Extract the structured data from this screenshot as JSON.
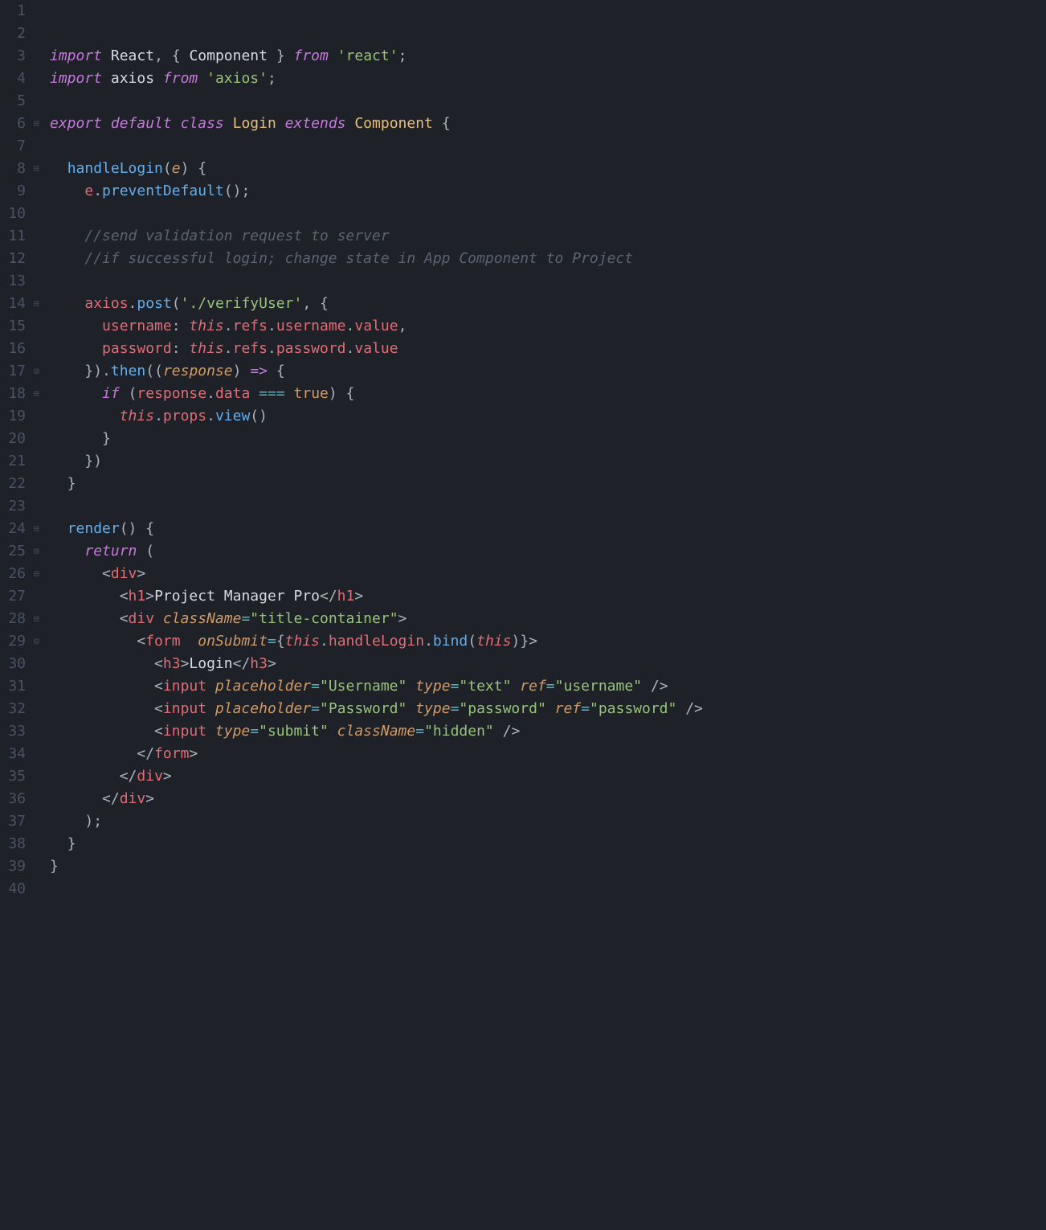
{
  "lines": [
    {
      "num": "1",
      "fold": "",
      "tokens": []
    },
    {
      "num": "2",
      "fold": "",
      "tokens": []
    },
    {
      "num": "3",
      "fold": "",
      "tokens": [
        {
          "cls": "kw-purple",
          "t": "import"
        },
        {
          "cls": "punct",
          "t": " "
        },
        {
          "cls": "white",
          "t": "React"
        },
        {
          "cls": "punct",
          "t": ", "
        },
        {
          "cls": "brace",
          "t": "{ "
        },
        {
          "cls": "white",
          "t": "Component"
        },
        {
          "cls": "brace",
          "t": " } "
        },
        {
          "cls": "kw-purple",
          "t": "from"
        },
        {
          "cls": "punct",
          "t": " "
        },
        {
          "cls": "string",
          "t": "'react'"
        },
        {
          "cls": "punct",
          "t": ";"
        }
      ]
    },
    {
      "num": "4",
      "fold": "",
      "tokens": [
        {
          "cls": "kw-purple",
          "t": "import"
        },
        {
          "cls": "punct",
          "t": " "
        },
        {
          "cls": "white",
          "t": "axios"
        },
        {
          "cls": "punct",
          "t": " "
        },
        {
          "cls": "kw-purple",
          "t": "from"
        },
        {
          "cls": "punct",
          "t": " "
        },
        {
          "cls": "string",
          "t": "'axios'"
        },
        {
          "cls": "punct",
          "t": ";"
        }
      ]
    },
    {
      "num": "5",
      "fold": "",
      "tokens": []
    },
    {
      "num": "6",
      "fold": "⊟",
      "tokens": [
        {
          "cls": "kw-purple",
          "t": "export"
        },
        {
          "cls": "punct",
          "t": " "
        },
        {
          "cls": "kw-purple",
          "t": "default"
        },
        {
          "cls": "punct",
          "t": " "
        },
        {
          "cls": "kw-purple",
          "t": "class"
        },
        {
          "cls": "punct",
          "t": " "
        },
        {
          "cls": "class-yellow",
          "t": "Login"
        },
        {
          "cls": "punct",
          "t": " "
        },
        {
          "cls": "kw-purple",
          "t": "extends"
        },
        {
          "cls": "punct",
          "t": " "
        },
        {
          "cls": "class-yellow",
          "t": "Component"
        },
        {
          "cls": "punct",
          "t": " "
        },
        {
          "cls": "brace",
          "t": "{"
        }
      ]
    },
    {
      "num": "7",
      "fold": "",
      "tokens": [
        {
          "cls": "indent-guide",
          "t": "  "
        }
      ]
    },
    {
      "num": "8",
      "fold": "⊟",
      "tokens": [
        {
          "cls": "punct",
          "t": "  "
        },
        {
          "cls": "ident-blue",
          "t": "handleLogin"
        },
        {
          "cls": "brace",
          "t": "("
        },
        {
          "cls": "param-orange",
          "t": "e"
        },
        {
          "cls": "brace",
          "t": ")"
        },
        {
          "cls": "punct",
          "t": " "
        },
        {
          "cls": "brace",
          "t": "{"
        }
      ]
    },
    {
      "num": "9",
      "fold": "",
      "tokens": [
        {
          "cls": "punct",
          "t": "    "
        },
        {
          "cls": "prop-red",
          "t": "e"
        },
        {
          "cls": "punct",
          "t": "."
        },
        {
          "cls": "ident-blue",
          "t": "preventDefault"
        },
        {
          "cls": "brace",
          "t": "()"
        },
        {
          "cls": "punct",
          "t": ";"
        }
      ]
    },
    {
      "num": "10",
      "fold": "",
      "tokens": [
        {
          "cls": "punct",
          "t": "    "
        }
      ]
    },
    {
      "num": "11",
      "fold": "",
      "tokens": [
        {
          "cls": "punct",
          "t": "    "
        },
        {
          "cls": "comment",
          "t": "//send validation request to server"
        }
      ]
    },
    {
      "num": "12",
      "fold": "",
      "tokens": [
        {
          "cls": "punct",
          "t": "    "
        },
        {
          "cls": "comment",
          "t": "//if successful login; change state in App Component to Project"
        }
      ]
    },
    {
      "num": "13",
      "fold": "",
      "tokens": [
        {
          "cls": "punct",
          "t": "    "
        }
      ]
    },
    {
      "num": "14",
      "fold": "⊟",
      "tokens": [
        {
          "cls": "punct",
          "t": "    "
        },
        {
          "cls": "prop-red",
          "t": "axios"
        },
        {
          "cls": "punct",
          "t": "."
        },
        {
          "cls": "ident-blue",
          "t": "post"
        },
        {
          "cls": "brace",
          "t": "("
        },
        {
          "cls": "string",
          "t": "'./verifyUser'"
        },
        {
          "cls": "punct",
          "t": ", "
        },
        {
          "cls": "brace",
          "t": "{"
        }
      ]
    },
    {
      "num": "15",
      "fold": "",
      "tokens": [
        {
          "cls": "punct",
          "t": "      "
        },
        {
          "cls": "prop-red",
          "t": "username"
        },
        {
          "cls": "punct",
          "t": ": "
        },
        {
          "cls": "this-red",
          "t": "this"
        },
        {
          "cls": "punct",
          "t": "."
        },
        {
          "cls": "prop-red",
          "t": "refs"
        },
        {
          "cls": "punct",
          "t": "."
        },
        {
          "cls": "prop-red",
          "t": "username"
        },
        {
          "cls": "punct",
          "t": "."
        },
        {
          "cls": "prop-red",
          "t": "value"
        },
        {
          "cls": "punct",
          "t": ","
        }
      ]
    },
    {
      "num": "16",
      "fold": "",
      "tokens": [
        {
          "cls": "punct",
          "t": "      "
        },
        {
          "cls": "prop-red",
          "t": "password"
        },
        {
          "cls": "punct",
          "t": ": "
        },
        {
          "cls": "this-red",
          "t": "this"
        },
        {
          "cls": "punct",
          "t": "."
        },
        {
          "cls": "prop-red",
          "t": "refs"
        },
        {
          "cls": "punct",
          "t": "."
        },
        {
          "cls": "prop-red",
          "t": "password"
        },
        {
          "cls": "punct",
          "t": "."
        },
        {
          "cls": "prop-red",
          "t": "value"
        }
      ]
    },
    {
      "num": "17",
      "fold": "⊟",
      "tokens": [
        {
          "cls": "punct",
          "t": "    "
        },
        {
          "cls": "brace",
          "t": "})"
        },
        {
          "cls": "punct",
          "t": "."
        },
        {
          "cls": "ident-blue",
          "t": "then"
        },
        {
          "cls": "brace",
          "t": "(("
        },
        {
          "cls": "param-orange",
          "t": "response"
        },
        {
          "cls": "brace",
          "t": ")"
        },
        {
          "cls": "punct",
          "t": " "
        },
        {
          "cls": "kw-purple-plain",
          "t": "=>"
        },
        {
          "cls": "punct",
          "t": " "
        },
        {
          "cls": "brace",
          "t": "{"
        }
      ]
    },
    {
      "num": "18",
      "fold": "⊟",
      "tokens": [
        {
          "cls": "punct",
          "t": "      "
        },
        {
          "cls": "kw-purple",
          "t": "if"
        },
        {
          "cls": "punct",
          "t": " "
        },
        {
          "cls": "brace",
          "t": "("
        },
        {
          "cls": "prop-red",
          "t": "response"
        },
        {
          "cls": "punct",
          "t": "."
        },
        {
          "cls": "prop-red",
          "t": "data"
        },
        {
          "cls": "punct",
          "t": " "
        },
        {
          "cls": "operator",
          "t": "==="
        },
        {
          "cls": "punct",
          "t": " "
        },
        {
          "cls": "const-orange",
          "t": "true"
        },
        {
          "cls": "brace",
          "t": ")"
        },
        {
          "cls": "punct",
          "t": " "
        },
        {
          "cls": "brace",
          "t": "{"
        }
      ]
    },
    {
      "num": "19",
      "fold": "",
      "tokens": [
        {
          "cls": "punct",
          "t": "        "
        },
        {
          "cls": "this-red",
          "t": "this"
        },
        {
          "cls": "punct",
          "t": "."
        },
        {
          "cls": "prop-red",
          "t": "props"
        },
        {
          "cls": "punct",
          "t": "."
        },
        {
          "cls": "ident-blue",
          "t": "view"
        },
        {
          "cls": "brace",
          "t": "()"
        }
      ]
    },
    {
      "num": "20",
      "fold": "",
      "tokens": [
        {
          "cls": "punct",
          "t": "      "
        },
        {
          "cls": "brace",
          "t": "}"
        }
      ]
    },
    {
      "num": "21",
      "fold": "",
      "tokens": [
        {
          "cls": "punct",
          "t": "    "
        },
        {
          "cls": "brace",
          "t": "})"
        }
      ]
    },
    {
      "num": "22",
      "fold": "",
      "tokens": [
        {
          "cls": "punct",
          "t": "  "
        },
        {
          "cls": "brace",
          "t": "}"
        }
      ]
    },
    {
      "num": "23",
      "fold": "",
      "tokens": [
        {
          "cls": "punct",
          "t": "  "
        }
      ]
    },
    {
      "num": "24",
      "fold": "⊟",
      "tokens": [
        {
          "cls": "punct",
          "t": "  "
        },
        {
          "cls": "ident-blue",
          "t": "render"
        },
        {
          "cls": "brace",
          "t": "()"
        },
        {
          "cls": "punct",
          "t": " "
        },
        {
          "cls": "brace",
          "t": "{"
        }
      ]
    },
    {
      "num": "25",
      "fold": "⊟",
      "tokens": [
        {
          "cls": "punct",
          "t": "    "
        },
        {
          "cls": "kw-purple",
          "t": "return"
        },
        {
          "cls": "punct",
          "t": " "
        },
        {
          "cls": "brace",
          "t": "("
        }
      ]
    },
    {
      "num": "26",
      "fold": "⊟",
      "tokens": [
        {
          "cls": "punct",
          "t": "      "
        },
        {
          "cls": "tag-angle",
          "t": "<"
        },
        {
          "cls": "tag-red",
          "t": "div"
        },
        {
          "cls": "tag-angle",
          "t": ">"
        }
      ]
    },
    {
      "num": "27",
      "fold": "",
      "tokens": [
        {
          "cls": "punct",
          "t": "        "
        },
        {
          "cls": "tag-angle",
          "t": "<"
        },
        {
          "cls": "tag-red",
          "t": "h1"
        },
        {
          "cls": "tag-angle",
          "t": ">"
        },
        {
          "cls": "white",
          "t": "Project Manager Pro"
        },
        {
          "cls": "tag-angle",
          "t": "</"
        },
        {
          "cls": "tag-red",
          "t": "h1"
        },
        {
          "cls": "tag-angle",
          "t": ">"
        }
      ]
    },
    {
      "num": "28",
      "fold": "⊟",
      "tokens": [
        {
          "cls": "punct",
          "t": "        "
        },
        {
          "cls": "tag-angle",
          "t": "<"
        },
        {
          "cls": "tag-red",
          "t": "div"
        },
        {
          "cls": "punct",
          "t": " "
        },
        {
          "cls": "attr-name",
          "t": "className"
        },
        {
          "cls": "operator",
          "t": "="
        },
        {
          "cls": "string",
          "t": "\"title-container\""
        },
        {
          "cls": "tag-angle",
          "t": ">"
        }
      ]
    },
    {
      "num": "29",
      "fold": "⊟",
      "tokens": [
        {
          "cls": "punct",
          "t": "          "
        },
        {
          "cls": "tag-angle",
          "t": "<"
        },
        {
          "cls": "tag-red",
          "t": "form"
        },
        {
          "cls": "punct",
          "t": "  "
        },
        {
          "cls": "attr-name",
          "t": "onSubmit"
        },
        {
          "cls": "operator",
          "t": "="
        },
        {
          "cls": "brace",
          "t": "{"
        },
        {
          "cls": "this-red",
          "t": "this"
        },
        {
          "cls": "punct",
          "t": "."
        },
        {
          "cls": "prop-red",
          "t": "handleLogin"
        },
        {
          "cls": "punct",
          "t": "."
        },
        {
          "cls": "ident-blue",
          "t": "bind"
        },
        {
          "cls": "brace",
          "t": "("
        },
        {
          "cls": "this-red",
          "t": "this"
        },
        {
          "cls": "brace",
          "t": ")}"
        },
        {
          "cls": "tag-angle",
          "t": ">"
        }
      ]
    },
    {
      "num": "30",
      "fold": "",
      "tokens": [
        {
          "cls": "punct",
          "t": "            "
        },
        {
          "cls": "tag-angle",
          "t": "<"
        },
        {
          "cls": "tag-red",
          "t": "h3"
        },
        {
          "cls": "tag-angle",
          "t": ">"
        },
        {
          "cls": "white",
          "t": "Login"
        },
        {
          "cls": "tag-angle",
          "t": "</"
        },
        {
          "cls": "tag-red",
          "t": "h3"
        },
        {
          "cls": "tag-angle",
          "t": ">"
        }
      ]
    },
    {
      "num": "31",
      "fold": "",
      "tokens": [
        {
          "cls": "punct",
          "t": "            "
        },
        {
          "cls": "tag-angle",
          "t": "<"
        },
        {
          "cls": "tag-red",
          "t": "input"
        },
        {
          "cls": "punct",
          "t": " "
        },
        {
          "cls": "attr-name",
          "t": "placeholder"
        },
        {
          "cls": "operator",
          "t": "="
        },
        {
          "cls": "string",
          "t": "\"Username\""
        },
        {
          "cls": "punct",
          "t": " "
        },
        {
          "cls": "attr-name",
          "t": "type"
        },
        {
          "cls": "operator",
          "t": "="
        },
        {
          "cls": "string",
          "t": "\"text\""
        },
        {
          "cls": "punct",
          "t": " "
        },
        {
          "cls": "attr-name",
          "t": "ref"
        },
        {
          "cls": "operator",
          "t": "="
        },
        {
          "cls": "string",
          "t": "\"username\""
        },
        {
          "cls": "punct",
          "t": " "
        },
        {
          "cls": "tag-angle",
          "t": "/>"
        }
      ]
    },
    {
      "num": "32",
      "fold": "",
      "tokens": [
        {
          "cls": "punct",
          "t": "            "
        },
        {
          "cls": "tag-angle",
          "t": "<"
        },
        {
          "cls": "tag-red",
          "t": "input"
        },
        {
          "cls": "punct",
          "t": " "
        },
        {
          "cls": "attr-name",
          "t": "placeholder"
        },
        {
          "cls": "operator",
          "t": "="
        },
        {
          "cls": "string",
          "t": "\"Password\""
        },
        {
          "cls": "punct",
          "t": " "
        },
        {
          "cls": "attr-name",
          "t": "type"
        },
        {
          "cls": "operator",
          "t": "="
        },
        {
          "cls": "string",
          "t": "\"password\""
        },
        {
          "cls": "punct",
          "t": " "
        },
        {
          "cls": "attr-name",
          "t": "ref"
        },
        {
          "cls": "operator",
          "t": "="
        },
        {
          "cls": "string",
          "t": "\"password\""
        },
        {
          "cls": "punct",
          "t": " "
        },
        {
          "cls": "tag-angle",
          "t": "/>"
        }
      ]
    },
    {
      "num": "33",
      "fold": "",
      "tokens": [
        {
          "cls": "punct",
          "t": "            "
        },
        {
          "cls": "tag-angle",
          "t": "<"
        },
        {
          "cls": "tag-red",
          "t": "input"
        },
        {
          "cls": "punct",
          "t": " "
        },
        {
          "cls": "attr-name",
          "t": "type"
        },
        {
          "cls": "operator",
          "t": "="
        },
        {
          "cls": "string",
          "t": "\"submit\""
        },
        {
          "cls": "punct",
          "t": " "
        },
        {
          "cls": "attr-name",
          "t": "className"
        },
        {
          "cls": "operator",
          "t": "="
        },
        {
          "cls": "string",
          "t": "\"hidden\""
        },
        {
          "cls": "punct",
          "t": " "
        },
        {
          "cls": "tag-angle",
          "t": "/>"
        }
      ]
    },
    {
      "num": "34",
      "fold": "",
      "tokens": [
        {
          "cls": "punct",
          "t": "          "
        },
        {
          "cls": "tag-angle",
          "t": "</"
        },
        {
          "cls": "tag-red",
          "t": "form"
        },
        {
          "cls": "tag-angle",
          "t": ">"
        }
      ]
    },
    {
      "num": "35",
      "fold": "",
      "tokens": [
        {
          "cls": "punct",
          "t": "        "
        },
        {
          "cls": "tag-angle",
          "t": "</"
        },
        {
          "cls": "tag-red",
          "t": "div"
        },
        {
          "cls": "tag-angle",
          "t": ">"
        }
      ]
    },
    {
      "num": "36",
      "fold": "",
      "tokens": [
        {
          "cls": "punct",
          "t": "      "
        },
        {
          "cls": "tag-angle",
          "t": "</"
        },
        {
          "cls": "tag-red",
          "t": "div"
        },
        {
          "cls": "tag-angle",
          "t": ">"
        }
      ]
    },
    {
      "num": "37",
      "fold": "",
      "tokens": [
        {
          "cls": "punct",
          "t": "    "
        },
        {
          "cls": "brace",
          "t": ")"
        },
        {
          "cls": "punct",
          "t": ";"
        }
      ]
    },
    {
      "num": "38",
      "fold": "",
      "tokens": [
        {
          "cls": "punct",
          "t": "  "
        },
        {
          "cls": "brace",
          "t": "}"
        }
      ]
    },
    {
      "num": "39",
      "fold": "",
      "tokens": [
        {
          "cls": "brace",
          "t": "}"
        }
      ]
    },
    {
      "num": "40",
      "fold": "",
      "tokens": []
    }
  ]
}
